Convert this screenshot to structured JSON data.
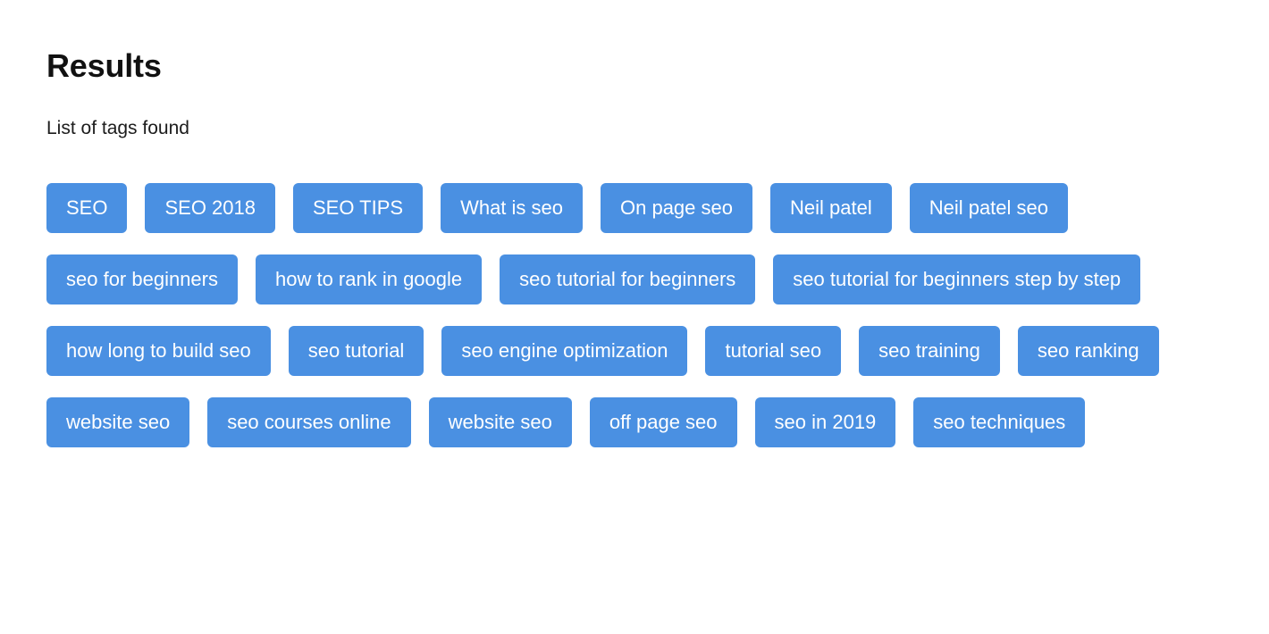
{
  "header": {
    "title": "Results",
    "subtitle": "List of tags found"
  },
  "theme": {
    "tag_background": "#4a90e2",
    "tag_text": "#ffffff",
    "page_background": "#ffffff",
    "heading_text": "#111111"
  },
  "tags": [
    {
      "label": "SEO"
    },
    {
      "label": "SEO 2018"
    },
    {
      "label": "SEO TIPS"
    },
    {
      "label": "What is seo"
    },
    {
      "label": "On page seo"
    },
    {
      "label": "Neil patel"
    },
    {
      "label": "Neil patel seo"
    },
    {
      "label": "seo for beginners"
    },
    {
      "label": "how to rank in google"
    },
    {
      "label": "seo tutorial for beginners"
    },
    {
      "label": "seo tutorial for beginners step by step"
    },
    {
      "label": "how long to build seo"
    },
    {
      "label": "seo tutorial"
    },
    {
      "label": "seo engine optimization"
    },
    {
      "label": "tutorial seo"
    },
    {
      "label": "seo training"
    },
    {
      "label": "seo ranking"
    },
    {
      "label": "website seo"
    },
    {
      "label": "seo courses online"
    },
    {
      "label": "website seo"
    },
    {
      "label": "off page seo"
    },
    {
      "label": "seo in 2019"
    },
    {
      "label": "seo techniques"
    }
  ]
}
